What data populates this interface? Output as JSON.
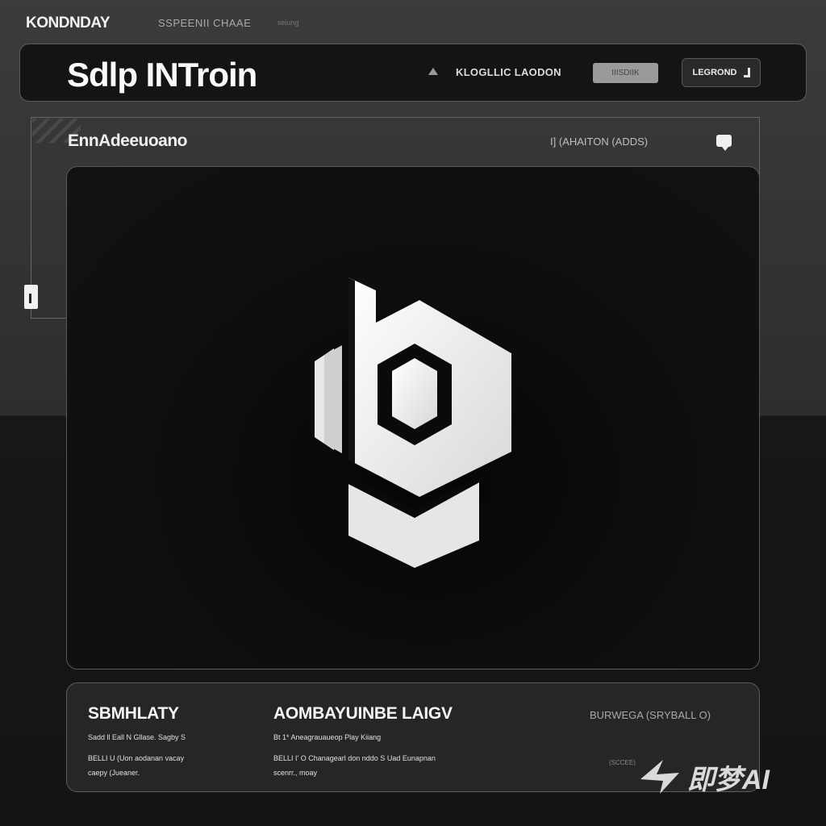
{
  "topbar": {
    "brand": "KONDNDAY",
    "nav_primary": "SSPEENII CHAAE",
    "nav_secondary": "seiung"
  },
  "header": {
    "title": "Sdlp INTroin",
    "link_label": "KLOGLLIC LAODON",
    "pill_label": "IIISDIIK",
    "button_label": "LEGROND"
  },
  "panel": {
    "title": "EnnAdeeuoano",
    "meta": "I] (AHAITON (ADDS)"
  },
  "footer": {
    "col1_title": "SBMHLATY",
    "col1_line1": "Sadd ll Eall N Gllase. Sagby S",
    "col1_line2": "BELLI U (Uon aodanan vacay\ncaepy (Jueaner.",
    "col2_title": "AOMBAYUINBE LAIGV",
    "col2_line1": "Bt 1* Aneagrauaueop Play Kiiang",
    "col2_line2": "BELLI I' O Chanagearl don nddo S Uad Eunapnan\nscenrr., moay",
    "col3_title": "BURWEGA (SRYBALL O)",
    "corner_note": "(SCCEE)"
  },
  "watermark": {
    "text": "即梦AI"
  },
  "colors": {
    "background_top": "#3b3b3b",
    "background_bottom": "#141414",
    "panel_dark": "#0e0e0e",
    "text_primary": "#f2f2f2",
    "accent_grey": "#9a9a9a"
  },
  "icons": {
    "header_caret": "triangle-up-icon",
    "header_button": "corner-bracket-icon",
    "panel_action": "comment-icon",
    "side_handle": "handle-icon",
    "center_logo": "hexagon-b-logo"
  }
}
